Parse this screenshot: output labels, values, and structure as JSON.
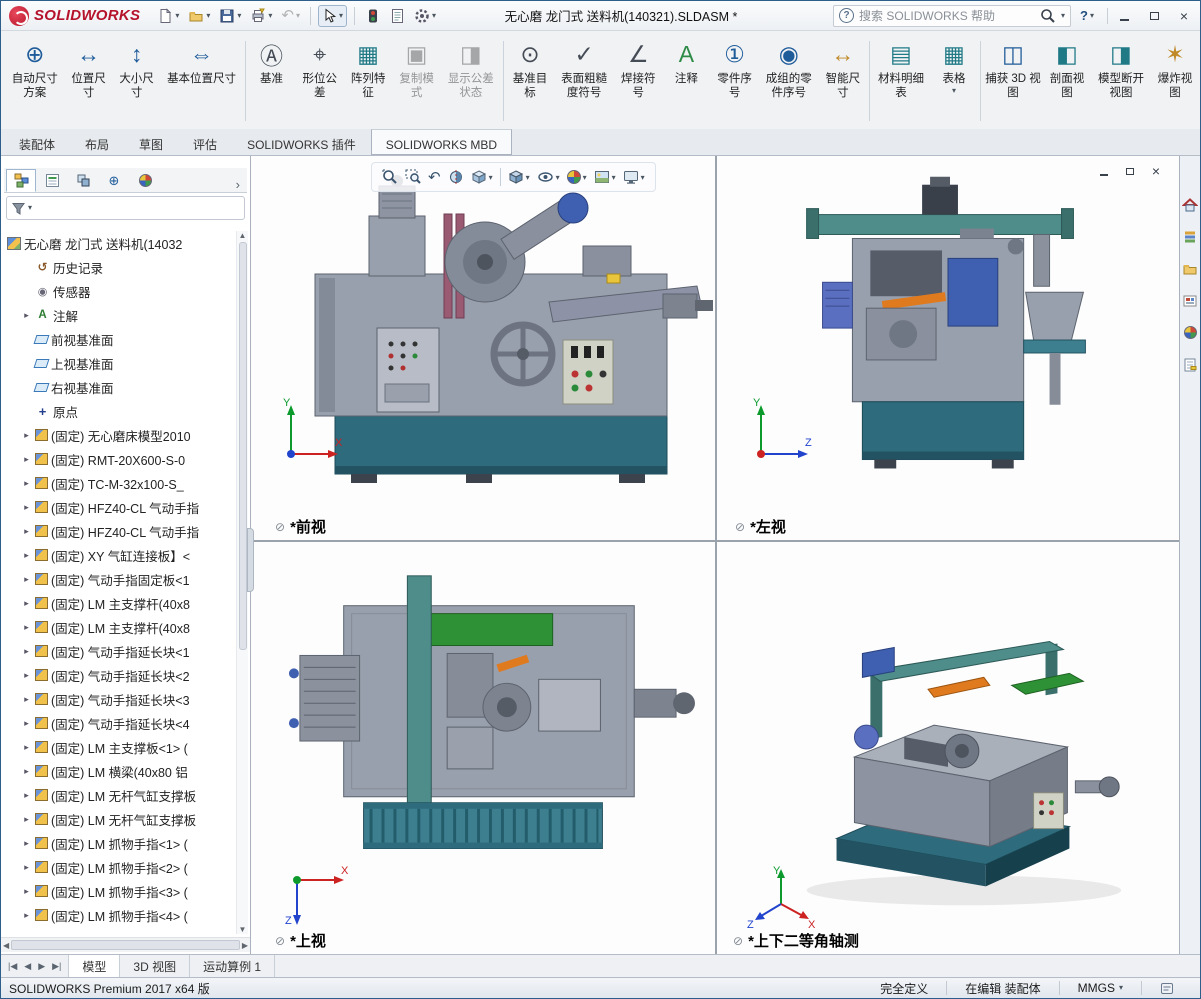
{
  "titlebar": {
    "brand": "SOLIDWORKS",
    "document_title": "无心磨 龙门式 送料机(140321).SLDASM *",
    "search_placeholder": "搜索 SOLIDWORKS 帮助",
    "help_glyph": "?"
  },
  "icons": {
    "caret": "▾",
    "chevron": "›",
    "up": "▲",
    "down": "▼",
    "left": "◀",
    "right": "▶",
    "tab_first": "|◀",
    "tab_last": "▶|",
    "undo": "↶",
    "prev_view": "↶",
    "close": "×",
    "help_bubble": "?",
    "view_marker": "⊘",
    "dimxpert": "⊕",
    "filter_caret": "▾"
  },
  "ribbon": {
    "groups": [
      [
        {
          "label": "自动尺寸方案",
          "icon": "auto-dimension-scheme-icon",
          "icon_class": "rbicon c-blue",
          "glyph": "⊕"
        },
        {
          "label": "位置尺寸",
          "icon": "location-dimension-icon",
          "icon_class": "rbicon c-blue",
          "glyph": "↔"
        },
        {
          "label": "大小尺寸",
          "icon": "size-dimension-icon",
          "icon_class": "rbicon c-blue",
          "glyph": "↕"
        },
        {
          "label": "基本位置尺寸",
          "icon": "basic-location-dimension-icon",
          "icon_class": "rbicon c-blue",
          "glyph": "⇔",
          "class": "wide"
        }
      ],
      [
        {
          "label": "基准",
          "icon": "datum-icon",
          "icon_class": "rbicon c-dark",
          "glyph": "Ⓐ"
        },
        {
          "label": "形位公差",
          "icon": "geometric-tolerance-icon",
          "icon_class": "rbicon c-dark",
          "glyph": "⌖"
        },
        {
          "label": "阵列特征",
          "icon": "pattern-feature-icon",
          "icon_class": "rbicon c-teal",
          "glyph": "▦"
        },
        {
          "label": "复制模式",
          "icon": "copy-scheme-icon",
          "icon_class": "rbicon c-dark",
          "glyph": "▣",
          "class": "disabled"
        },
        {
          "label": "显示公差状态",
          "icon": "show-tolerance-status-icon",
          "icon_class": "rbicon c-dark",
          "glyph": "◨",
          "class": "disabled"
        }
      ],
      [
        {
          "label": "基准目标",
          "icon": "datum-target-icon",
          "icon_class": "rbicon c-dark",
          "glyph": "⊙"
        },
        {
          "label": "表面粗糙度符号",
          "icon": "surface-finish-icon",
          "icon_class": "rbicon c-dark",
          "glyph": "✓"
        },
        {
          "label": "焊接符号",
          "icon": "weld-symbol-icon",
          "icon_class": "rbicon c-dark",
          "glyph": "∠"
        },
        {
          "label": "注释",
          "icon": "note-icon",
          "icon_class": "rbicon c-green",
          "glyph": "A"
        },
        {
          "label": "零件序号",
          "icon": "balloon-icon",
          "icon_class": "rbicon c-blue",
          "glyph": "①"
        },
        {
          "label": "成组的零件序号",
          "icon": "auto-balloon-icon",
          "icon_class": "rbicon c-blue",
          "glyph": "◉"
        },
        {
          "label": "智能尺寸",
          "icon": "smart-dimension-icon",
          "icon_class": "rbicon c-amber",
          "glyph": "↔"
        }
      ],
      [
        {
          "label": "材料明细表",
          "icon": "bill-of-materials-icon",
          "icon_class": "rbicon c-teal",
          "glyph": "▤"
        },
        {
          "label": "表格",
          "icon": "tables-icon",
          "icon_class": "rbicon c-teal",
          "glyph": "▦",
          "caret": "▾"
        }
      ],
      [
        {
          "label": "捕获 3D 视图",
          "icon": "capture-3d-view-icon",
          "icon_class": "rbicon c-blue",
          "glyph": "◫"
        },
        {
          "label": "剖面视图",
          "icon": "section-view-icon",
          "icon_class": "rbicon c-teal",
          "glyph": "◧"
        },
        {
          "label": "模型断开视图",
          "icon": "model-break-view-icon",
          "icon_class": "rbicon c-teal",
          "glyph": "◨"
        },
        {
          "label": "爆炸视图",
          "icon": "exploded-view-icon",
          "icon_class": "rbicon c-amber",
          "glyph": "✶"
        }
      ]
    ]
  },
  "command_tabs": [
    {
      "label": "装配体"
    },
    {
      "label": "布局"
    },
    {
      "label": "草图"
    },
    {
      "label": "评估"
    },
    {
      "label": "SOLIDWORKS 插件"
    },
    {
      "label": "SOLIDWORKS MBD",
      "class": "active"
    }
  ],
  "panel": {
    "tree": {
      "root": {
        "label": "无心磨 龙门式 送料机(14032",
        "icon": "assembly-icon"
      },
      "items": [
        {
          "label": "历史记录",
          "icon": "history-icon",
          "icon_class": "ticon i-hist",
          "glyph": "↺",
          "arrow": ""
        },
        {
          "label": "传感器",
          "icon": "sensors-icon",
          "icon_class": "ticon i-sens",
          "glyph": "◉",
          "arrow": ""
        },
        {
          "label": "注解",
          "icon": "annotations-icon",
          "icon_class": "ticon i-ann",
          "glyph": "A",
          "arrow": "▸"
        },
        {
          "label": "前视基准面",
          "icon": "plane-icon",
          "icon_class": "ticon i-plane",
          "glyph": "",
          "arrow": ""
        },
        {
          "label": "上视基准面",
          "icon": "plane-icon",
          "icon_class": "ticon i-plane",
          "glyph": "",
          "arrow": ""
        },
        {
          "label": "右视基准面",
          "icon": "plane-icon",
          "icon_class": "ticon i-plane",
          "glyph": "",
          "arrow": ""
        },
        {
          "label": "原点",
          "icon": "origin-icon",
          "icon_class": "ticon i-origin",
          "glyph": "+",
          "arrow": ""
        },
        {
          "label": "(固定) 无心磨床模型2010",
          "icon": "component-icon",
          "icon_class": "ticon i-comp",
          "glyph": "",
          "arrow": "▸"
        },
        {
          "label": "(固定) RMT-20X600-S-0",
          "icon": "component-icon",
          "icon_class": "ticon i-comp",
          "glyph": "",
          "arrow": "▸"
        },
        {
          "label": "(固定) TC-M-32x100-S_",
          "icon": "component-icon",
          "icon_class": "ticon i-comp",
          "glyph": "",
          "arrow": "▸"
        },
        {
          "label": "(固定) HFZ40-CL 气动手指",
          "icon": "component-icon",
          "icon_class": "ticon i-comp",
          "glyph": "",
          "arrow": "▸"
        },
        {
          "label": "(固定) HFZ40-CL 气动手指",
          "icon": "component-icon",
          "icon_class": "ticon i-comp",
          "glyph": "",
          "arrow": "▸"
        },
        {
          "label": "(固定) XY 气缸连接板】<",
          "icon": "component-icon",
          "icon_class": "ticon i-comp",
          "glyph": "",
          "arrow": "▸"
        },
        {
          "label": "(固定) 气动手指固定板<1",
          "icon": "component-icon",
          "icon_class": "ticon i-comp",
          "glyph": "",
          "arrow": "▸"
        },
        {
          "label": "(固定) LM 主支撑杆(40x8",
          "icon": "component-icon",
          "icon_class": "ticon i-comp",
          "glyph": "",
          "arrow": "▸"
        },
        {
          "label": "(固定) LM 主支撑杆(40x8",
          "icon": "component-icon",
          "icon_class": "ticon i-comp",
          "glyph": "",
          "arrow": "▸"
        },
        {
          "label": "(固定) 气动手指延长块<1",
          "icon": "component-icon",
          "icon_class": "ticon i-comp",
          "glyph": "",
          "arrow": "▸"
        },
        {
          "label": "(固定) 气动手指延长块<2",
          "icon": "component-icon",
          "icon_class": "ticon i-comp",
          "glyph": "",
          "arrow": "▸"
        },
        {
          "label": "(固定) 气动手指延长块<3",
          "icon": "component-icon",
          "icon_class": "ticon i-comp",
          "glyph": "",
          "arrow": "▸"
        },
        {
          "label": "(固定) 气动手指延长块<4",
          "icon": "component-icon",
          "icon_class": "ticon i-comp",
          "glyph": "",
          "arrow": "▸"
        },
        {
          "label": "(固定) LM 主支撑板<1> (",
          "icon": "component-icon",
          "icon_class": "ticon i-comp",
          "glyph": "",
          "arrow": "▸"
        },
        {
          "label": "(固定) LM 横梁(40x80 铝",
          "icon": "component-icon",
          "icon_class": "ticon i-comp",
          "glyph": "",
          "arrow": "▸"
        },
        {
          "label": "(固定) LM 无杆气缸支撑板",
          "icon": "component-icon",
          "icon_class": "ticon i-comp",
          "glyph": "",
          "arrow": "▸"
        },
        {
          "label": "(固定) LM 无杆气缸支撑板",
          "icon": "component-icon",
          "icon_class": "ticon i-comp",
          "glyph": "",
          "arrow": "▸"
        },
        {
          "label": "(固定) LM 抓物手指<1> (",
          "icon": "component-icon",
          "icon_class": "ticon i-comp",
          "glyph": "",
          "arrow": "▸"
        },
        {
          "label": "(固定) LM 抓物手指<2> (",
          "icon": "component-icon",
          "icon_class": "ticon i-comp",
          "glyph": "",
          "arrow": "▸"
        },
        {
          "label": "(固定) LM 抓物手指<3> (",
          "icon": "component-icon",
          "icon_class": "ticon i-comp",
          "glyph": "",
          "arrow": "▸"
        },
        {
          "label": "(固定) LM 抓物手指<4> (",
          "icon": "component-icon",
          "icon_class": "ticon i-comp",
          "glyph": "",
          "arrow": "▸"
        }
      ]
    }
  },
  "viewport": {
    "views": [
      {
        "label": "*前视"
      },
      {
        "label": "*左视"
      },
      {
        "label": "*上视"
      },
      {
        "label": "*上下二等角轴测"
      }
    ],
    "triad": {
      "x": "X",
      "y": "Y",
      "z": "Z"
    }
  },
  "bottom_tabs": [
    {
      "label": "模型",
      "class": "active"
    },
    {
      "label": "3D 视图"
    },
    {
      "label": "运动算例 1"
    }
  ],
  "statusbar": {
    "product": "SOLIDWORKS Premium 2017 x64 版",
    "definition": "完全定义",
    "editing": "在编辑 装配体",
    "units": "MMGS"
  }
}
